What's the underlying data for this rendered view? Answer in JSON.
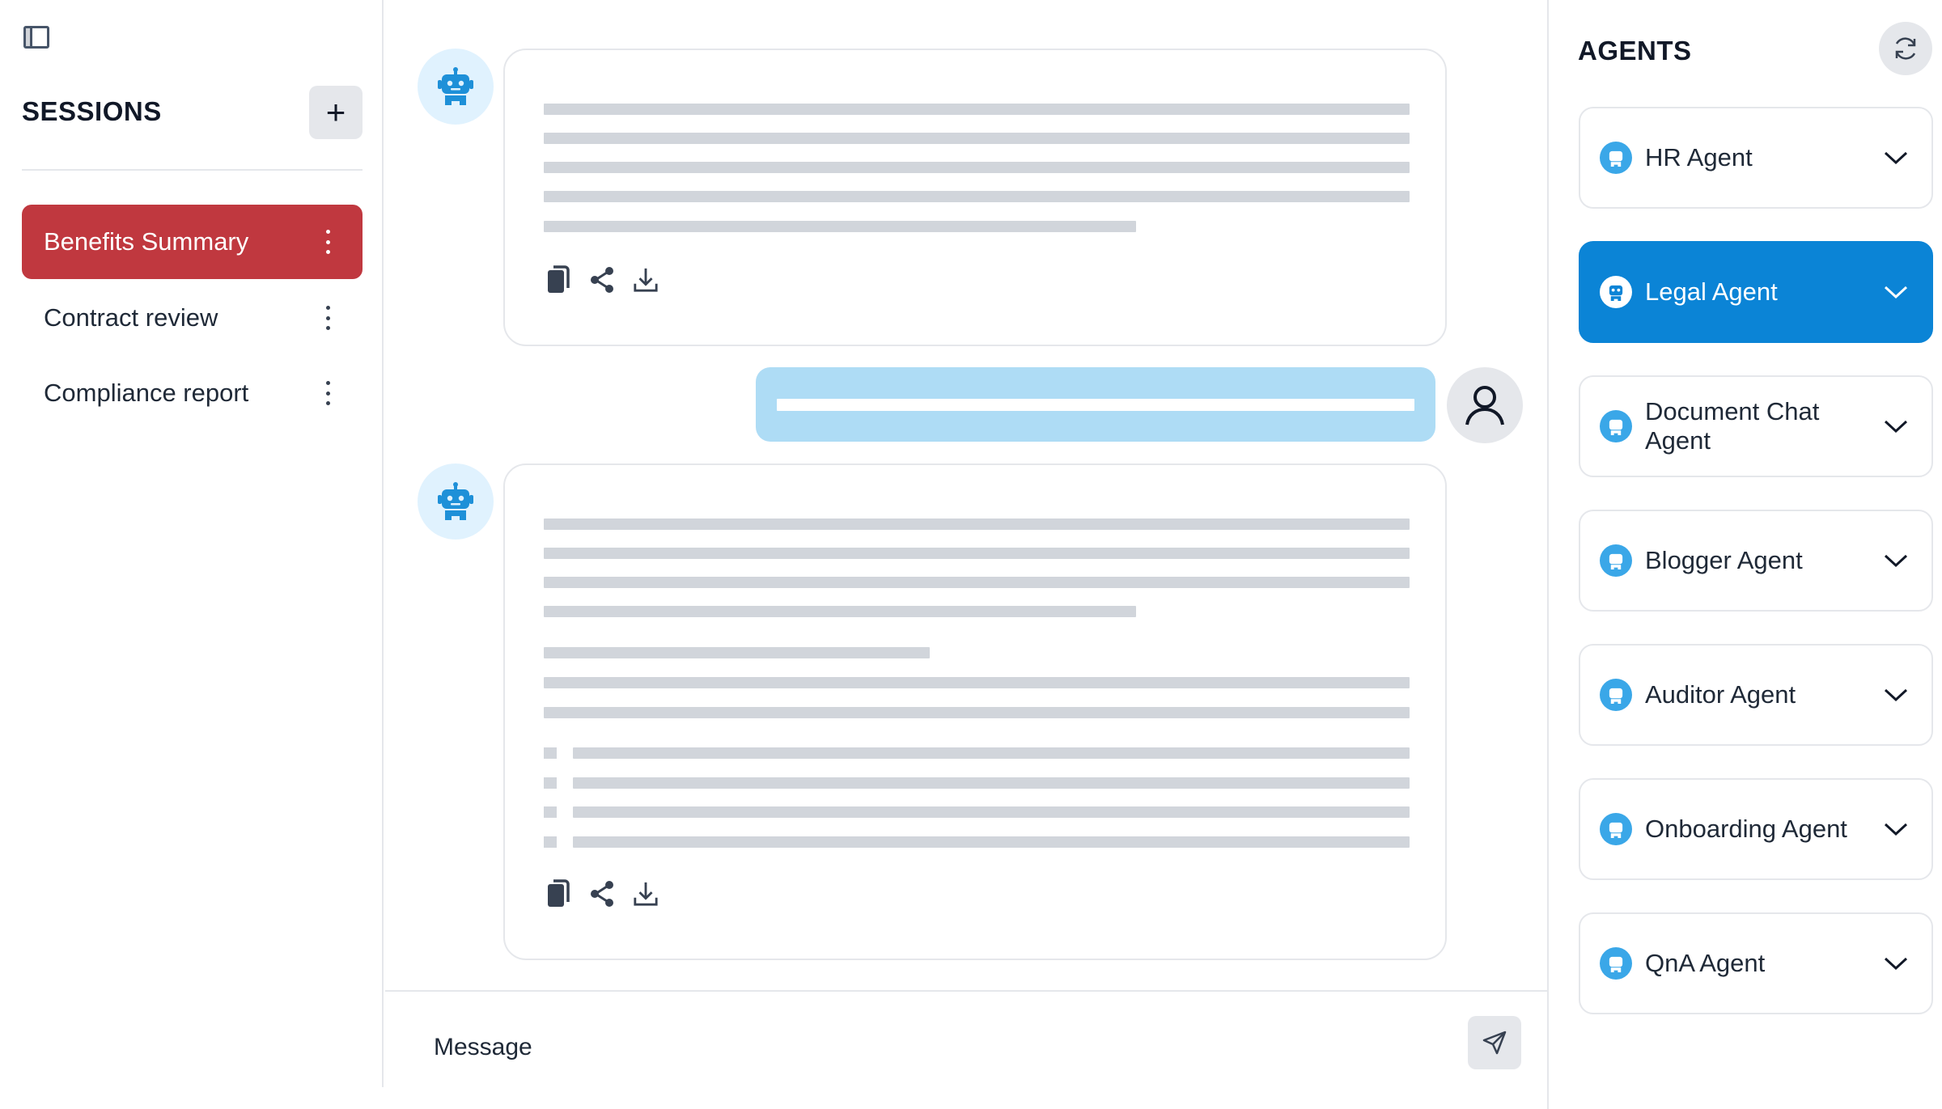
{
  "sidebar": {
    "title": "SESSIONS",
    "add_icon": "plus-icon",
    "toggle_icon": "sidebar-panel-icon",
    "items": [
      {
        "label": "Benefits Summary",
        "active": true
      },
      {
        "label": "Contract review",
        "active": false
      },
      {
        "label": "Compliance report",
        "active": false
      }
    ],
    "active_color": "#c0383f"
  },
  "chat": {
    "message_actions": [
      "copy-icon",
      "share-icon",
      "download-icon"
    ],
    "user_bubble_color": "#aedcf5",
    "bot_avatar_bg": "#e0f2fe"
  },
  "composer": {
    "placeholder": "Message",
    "send_icon": "send-icon"
  },
  "agents": {
    "title": "AGENTS",
    "refresh_icon": "refresh-icon",
    "selected_color": "#0b84d6",
    "items": [
      {
        "name": "HR Agent",
        "selected": false
      },
      {
        "name": "Legal Agent",
        "selected": true
      },
      {
        "name": "Document Chat Agent",
        "selected": false
      },
      {
        "name": "Blogger Agent",
        "selected": false
      },
      {
        "name": "Auditor Agent",
        "selected": false
      },
      {
        "name": "Onboarding Agent",
        "selected": false
      },
      {
        "name": "QnA Agent",
        "selected": false
      }
    ]
  }
}
